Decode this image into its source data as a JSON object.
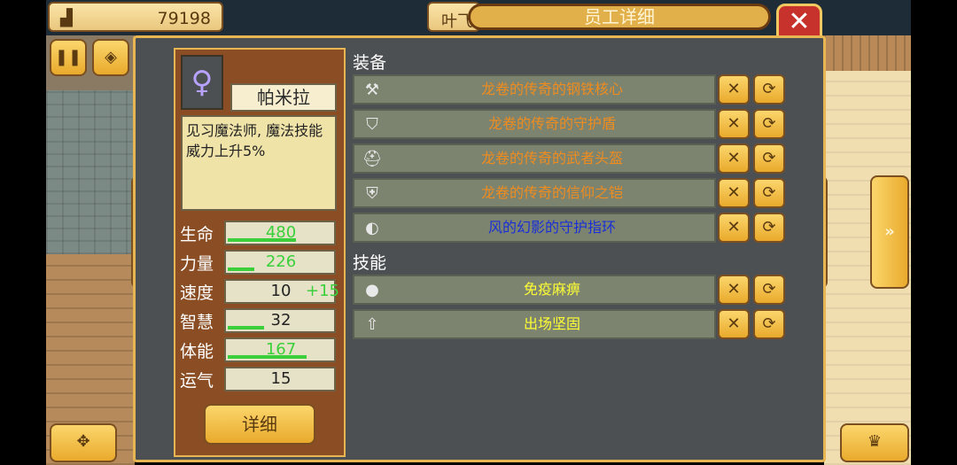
{
  "top": {
    "money_icon": "building-icon",
    "money": "79198",
    "name_partial": "叶飞",
    "window_title": "员工详细",
    "close_label": "✕"
  },
  "side_buttons": {
    "pause": "pause-icon",
    "cube": "cube-icon",
    "move": "move-icon",
    "crown": "crown-icon",
    "left_arrow": "«",
    "right_arrow": "»"
  },
  "employee": {
    "name": "帕米拉",
    "description": "见习魔法师, 魔法技能威力上升5%",
    "stats": [
      {
        "label": "生命",
        "value": "480",
        "fill": 0.65,
        "color": "#3bd03b",
        "bonus": ""
      },
      {
        "label": "力量",
        "value": "226",
        "fill": 0.25,
        "color": "#3bd03b",
        "bonus": ""
      },
      {
        "label": "速度",
        "value": "10",
        "fill": 0.0,
        "color": "#222222",
        "bonus": "+15"
      },
      {
        "label": "智慧",
        "value": "32",
        "fill": 0.35,
        "color": "#222222",
        "bonus": ""
      },
      {
        "label": "体能",
        "value": "167",
        "fill": 0.75,
        "color": "#3bd03b",
        "bonus": ""
      },
      {
        "label": "运气",
        "value": "15",
        "fill": 0.0,
        "color": "#222222",
        "bonus": ""
      }
    ],
    "detail_button": "详细"
  },
  "equipment": {
    "title": "装备",
    "items": [
      {
        "icon": "axe-icon",
        "glyph": "⚒",
        "label": "龙卷的传奇的钢铁核心",
        "color": "#f08c1e"
      },
      {
        "icon": "shield-icon",
        "glyph": "⛉",
        "label": "龙卷的传奇的守护盾",
        "color": "#f08c1e"
      },
      {
        "icon": "helmet-icon",
        "glyph": "⛑",
        "label": "龙卷的传奇的武者头盔",
        "color": "#f08c1e"
      },
      {
        "icon": "armor-icon",
        "glyph": "⛨",
        "label": "龙卷的传奇的信仰之铠",
        "color": "#f08c1e"
      },
      {
        "icon": "ring-icon",
        "glyph": "◐",
        "label": "风的幻影的守护指环",
        "color": "#1a2fd6"
      }
    ]
  },
  "skills": {
    "title": "技能",
    "items": [
      {
        "icon": "orb-icon",
        "glyph": "●",
        "label": "免疫麻痹",
        "color": "#ffff33"
      },
      {
        "icon": "up-arrow-icon",
        "glyph": "⇧",
        "label": "出场坚固",
        "color": "#ffff33"
      }
    ]
  },
  "actions": {
    "remove": "✕",
    "swap": "⟳"
  }
}
